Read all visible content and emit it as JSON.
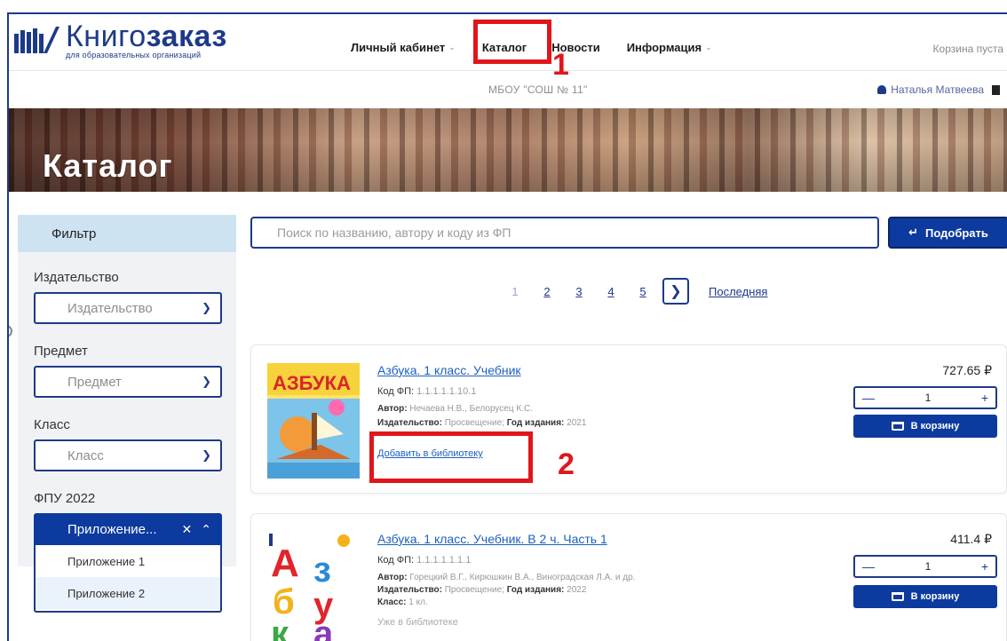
{
  "header": {
    "logo_title_light": "Книго",
    "logo_title_bold": "заказ",
    "logo_subtitle": "для образовательных организаций",
    "nav": [
      {
        "label": "Личный кабинет",
        "has_dropdown": true
      },
      {
        "label": "Каталог",
        "has_dropdown": false
      },
      {
        "label": "Новости",
        "has_dropdown": false
      },
      {
        "label": "Информация",
        "has_dropdown": true
      }
    ],
    "cart_status": "Корзина пуста",
    "organization": "МБОУ \"СОШ № 11\"",
    "user_name": "Наталья Матвеева"
  },
  "banner": {
    "title": "Каталог"
  },
  "annotations": {
    "marker_1": "1",
    "marker_2": "2"
  },
  "filter": {
    "title": "Фильтр",
    "fields": [
      {
        "label": "Издательство",
        "placeholder": "Издательство"
      },
      {
        "label": "Предмет",
        "placeholder": "Предмет"
      },
      {
        "label": "Класс",
        "placeholder": "Класс"
      }
    ],
    "fpu_label": "ФПУ 2022",
    "fpu_selected": "Приложение...",
    "fpu_options": [
      "Приложение 1",
      "Приложение 2"
    ]
  },
  "search": {
    "placeholder": "Поиск по названию, автору и коду из ФП",
    "button_label": "Подобрать"
  },
  "pagination": {
    "pages": [
      "1",
      "2",
      "3",
      "4",
      "5"
    ],
    "current": "1",
    "last_label": "Последняя"
  },
  "products": [
    {
      "title": "Азбука. 1 класс. Учебник",
      "code_label": "Код ФП:",
      "code": "1.1.1.1.1.10.1",
      "author_label": "Автор:",
      "author": "Нечаева Н.В., Белорусец К.С.",
      "publisher_label": "Издательство:",
      "publisher": "Просвещение;",
      "year_label": "Год издания:",
      "year": "2021",
      "library_action": "Добавить в библиотеку",
      "price": "727.65 ₽",
      "quantity": "1",
      "cart_label": "В корзину",
      "cover_text": "АЗБУКА"
    },
    {
      "title": "Азбука. 1 класс. Учебник. В 2 ч. Часть 1",
      "code_label": "Код ФП:",
      "code": "1.1.1.1.1.1.1",
      "author_label": "Автор:",
      "author": "Горецкий В.Г., Кирюшкин В.А., Виноградская Л.А. и др.",
      "publisher_label": "Издательство:",
      "publisher": "Просвещение;",
      "year_label": "Год издания:",
      "year": "2022",
      "grade_label": "Класс:",
      "grade": "1 кл.",
      "library_action": "Уже в библиотеке",
      "price": "411.4 ₽",
      "quantity": "1",
      "cart_label": "В корзину",
      "cover_letters": [
        "А",
        "з",
        "б",
        "у",
        "к",
        "а"
      ]
    }
  ],
  "colors": {
    "brand": "#1d3a8a",
    "button": "#0d3a9e",
    "annotation": "#e0161b",
    "filter_header": "#cde3f2"
  }
}
